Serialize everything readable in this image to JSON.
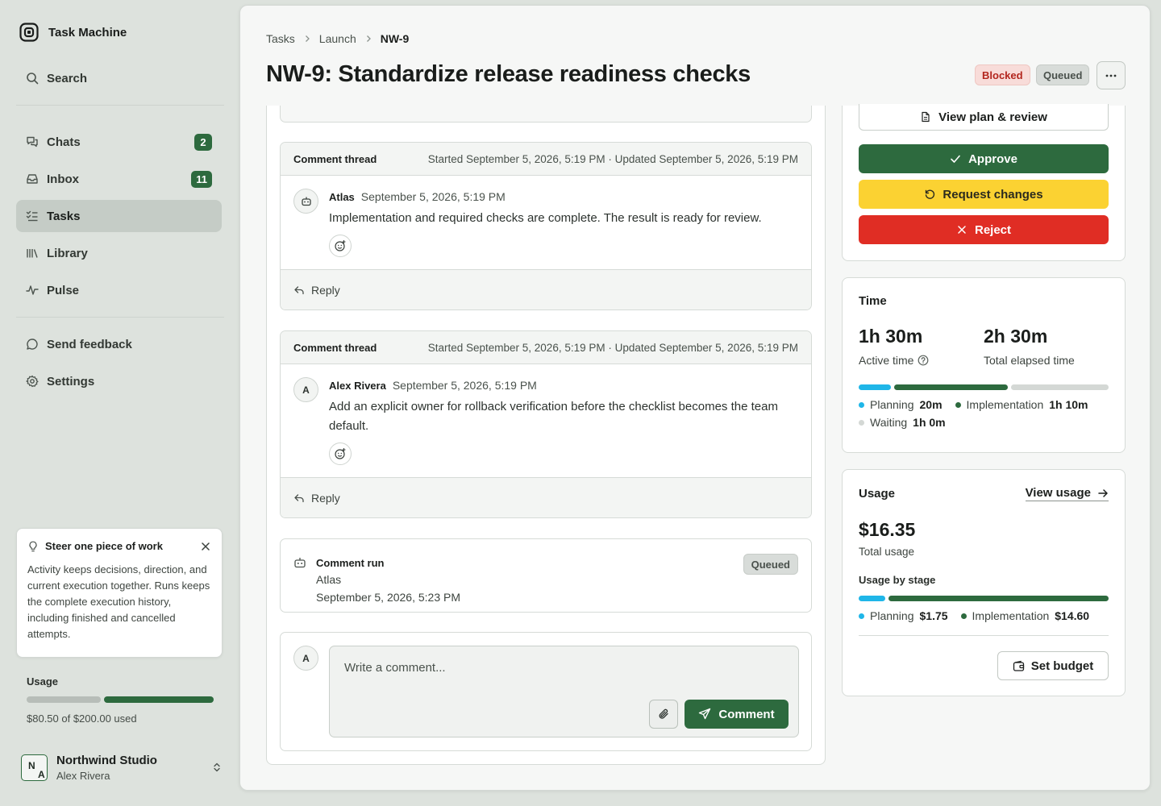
{
  "app": {
    "name": "Task Machine"
  },
  "sidebar": {
    "search_label": "Search",
    "items": [
      {
        "label": "Chats",
        "badge": "2",
        "icon": "chats-icon"
      },
      {
        "label": "Inbox",
        "badge": "11",
        "icon": "inbox-icon"
      },
      {
        "label": "Tasks",
        "badge": "",
        "icon": "tasks-icon",
        "active": true
      },
      {
        "label": "Library",
        "badge": "",
        "icon": "library-icon"
      },
      {
        "label": "Pulse",
        "badge": "",
        "icon": "pulse-icon"
      }
    ],
    "feedback_label": "Send feedback",
    "settings_label": "Settings",
    "tip": {
      "title": "Steer one piece of work",
      "body": "Activity keeps decisions, direction, and current execution together. Runs keeps the complete execution history, including finished and cancelled attempts."
    },
    "usage": {
      "title": "Usage",
      "text": "$80.50 of $200.00 used",
      "used": 80.5,
      "limit": 200
    },
    "workspace": {
      "name": "Northwind Studio",
      "user": "Alex Rivera",
      "avatar_initials_1": "N",
      "avatar_initials_2": "A"
    }
  },
  "header": {
    "breadcrumb": [
      "Tasks",
      "Launch",
      "NW-9"
    ],
    "title": "NW-9: Standardize release readiness checks",
    "status_blocked": "Blocked",
    "status_queued": "Queued",
    "more_label": "···"
  },
  "threads": [
    {
      "title": "Comment thread",
      "meta": "Started September 5, 2026, 5:19 PM · Updated September 5, 2026, 5:19 PM",
      "author": "Atlas",
      "avatar": "",
      "avatar_icon": "robot-icon",
      "time": "September 5, 2026, 5:19 PM",
      "text": "Implementation and required checks are complete. The result is ready for review.",
      "reply_label": "Reply"
    },
    {
      "title": "Comment thread",
      "meta": "Started September 5, 2026, 5:19 PM · Updated September 5, 2026, 5:19 PM",
      "author": "Alex Rivera",
      "avatar": "A",
      "time": "September 5, 2026, 5:19 PM",
      "text": "Add an explicit owner for rollback verification before the checklist becomes the team default.",
      "reply_label": "Reply"
    }
  ],
  "run": {
    "title": "Comment run",
    "status": "Queued",
    "agent": "Atlas",
    "time": "September 5, 2026, 5:23 PM"
  },
  "composer": {
    "avatar": "A",
    "placeholder": "Write a comment...",
    "submit_label": "Comment"
  },
  "actions": {
    "view_plan_label": "View plan & review",
    "approve_label": "Approve",
    "request_changes_label": "Request changes",
    "reject_label": "Reject"
  },
  "time_card": {
    "title": "Time",
    "active_value": "1h 30m",
    "active_label": "Active time",
    "elapsed_value": "2h 30m",
    "elapsed_label": "Total elapsed time",
    "segments": [
      {
        "name": "Planning",
        "value": "20m",
        "minutes": 20,
        "color": "#1fb6e8"
      },
      {
        "name": "Implementation",
        "value": "1h 10m",
        "minutes": 70,
        "color": "#2d6a3e"
      },
      {
        "name": "Waiting",
        "value": "1h 0m",
        "minutes": 60,
        "color": "#d4d8d5"
      }
    ]
  },
  "usage_card": {
    "title": "Usage",
    "view_label": "View usage",
    "total": "$16.35",
    "total_label": "Total usage",
    "stage_title": "Usage by stage",
    "segments": [
      {
        "name": "Planning",
        "value": "$1.75",
        "amount": 1.75,
        "color": "#1fb6e8"
      },
      {
        "name": "Implementation",
        "value": "$14.60",
        "amount": 14.6,
        "color": "#2d6a3e"
      }
    ],
    "budget_label": "Set budget"
  },
  "colors": {
    "accent_green": "#2d6a3e",
    "warning_yellow": "#fbd232",
    "danger_red": "#e02d24",
    "planning_blue": "#1fb6e8"
  }
}
